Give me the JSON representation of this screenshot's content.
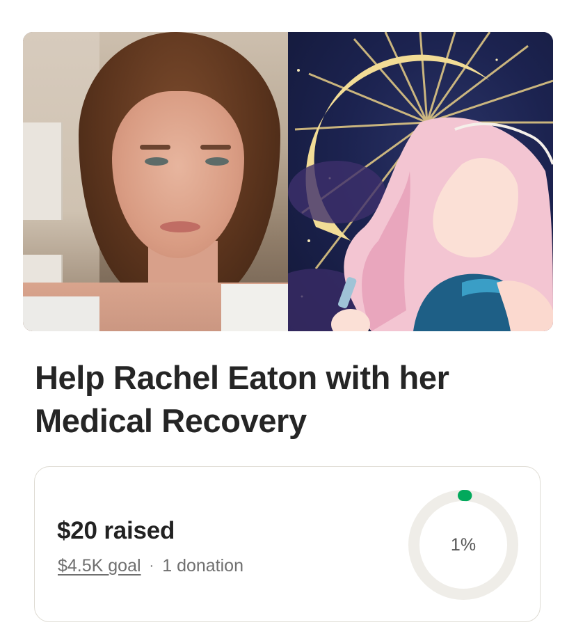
{
  "campaign": {
    "title": "Help Rachel Eaton with her Medical Recovery"
  },
  "progress": {
    "raised_label": "$20 raised",
    "goal_label": "$4.5K goal",
    "separator": "·",
    "donations_label": "1 donation",
    "percent_label": "1%",
    "percent_value": 0.01,
    "colors": {
      "ring_track": "#efede8",
      "ring_fill": "#02a95c"
    }
  },
  "colors": {
    "title_text": "#252525",
    "muted_text": "#6f6f6f",
    "card_border": "#dedbd3"
  }
}
